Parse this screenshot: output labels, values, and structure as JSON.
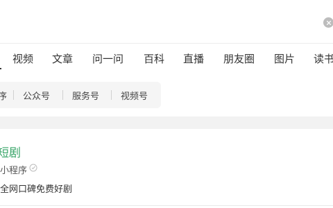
{
  "search": {
    "value": "",
    "placeholder": ""
  },
  "tabs": [
    "视频",
    "文章",
    "问一问",
    "百科",
    "直播",
    "朋友圈",
    "图片",
    "读书"
  ],
  "subfilters": [
    "序",
    "公众号",
    "服务号",
    "视频号"
  ],
  "result": {
    "title": "短剧",
    "type": "小程序",
    "description": "全网口碑免费好剧"
  },
  "colors": {
    "accent_green": "#3aa66a",
    "band_gray": "#f2f2f2"
  },
  "icons": {
    "clear": "clear-icon",
    "verified": "verified-icon"
  }
}
